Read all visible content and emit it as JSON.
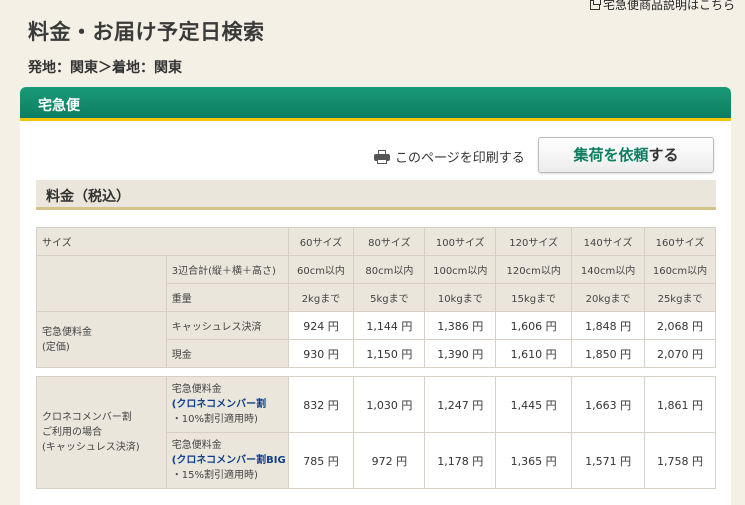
{
  "top_link": "宅急便商品説明はこちら",
  "title": "料金・お届け予定日検索",
  "route": "発地：関東＞着地：関東",
  "panel_title": "宅急便",
  "print_label": "このページを印刷する",
  "pickup_button": {
    "part1": "集荷を依頼",
    "part2": "する"
  },
  "section_title": "料金（税込）",
  "size_label": "サイズ",
  "sizes": [
    "60サイズ",
    "80サイズ",
    "100サイズ",
    "120サイズ",
    "140サイズ",
    "160サイズ"
  ],
  "dim_label": "3辺合計(縦＋横＋高さ)",
  "dims": [
    "60cm以内",
    "80cm以内",
    "100cm以内",
    "120cm以内",
    "140cm以内",
    "160cm以内"
  ],
  "weight_label": "重量",
  "weights": [
    "2kgまで",
    "5kgまで",
    "10kgまで",
    "15kgまで",
    "20kgまで",
    "25kgまで"
  ],
  "regular": {
    "label": "宅急便料金\n(定価)",
    "rows": [
      {
        "label": "キャッシュレス決済",
        "prices": [
          "924 円",
          "1,144 円",
          "1,386 円",
          "1,606 円",
          "1,848 円",
          "2,068 円"
        ]
      },
      {
        "label": "現金",
        "prices": [
          "930 円",
          "1,150 円",
          "1,390 円",
          "1,610 円",
          "1,850 円",
          "2,070 円"
        ]
      }
    ]
  },
  "member": {
    "label": "クロネコメンバー割\nご利用の場合\n(キャッシュレス決済)",
    "rows": [
      {
        "line1": "宅急便料金",
        "plan": "(クロネコメンバー割",
        "note": "・10%割引適用時)",
        "prices": [
          "832 円",
          "1,030 円",
          "1,247 円",
          "1,445 円",
          "1,663 円",
          "1,861 円"
        ]
      },
      {
        "line1": "宅急便料金",
        "plan": "(クロネコメンバー割BIG",
        "note": "・15%割引適用時)",
        "prices": [
          "785 円",
          "972 円",
          "1,178 円",
          "1,365 円",
          "1,571 円",
          "1,758 円"
        ]
      }
    ]
  }
}
